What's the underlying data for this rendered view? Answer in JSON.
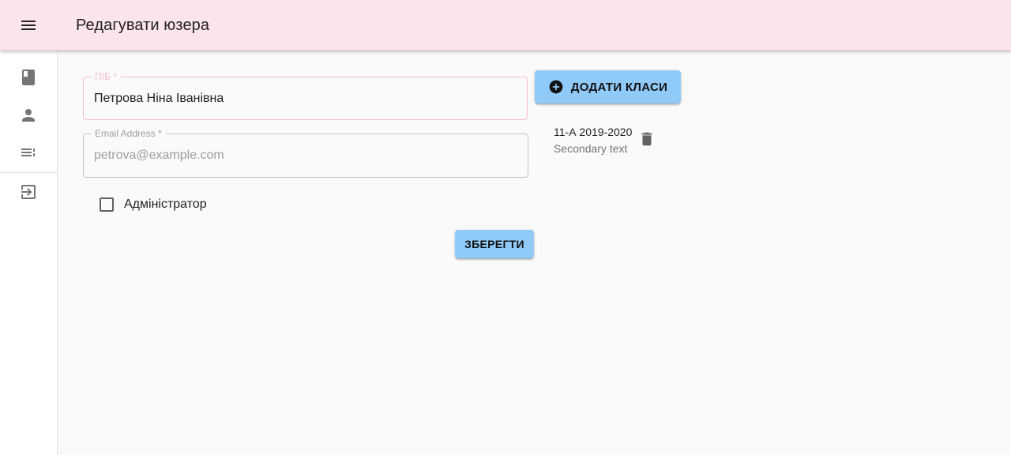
{
  "app_bar": {
    "title": "Редагувати юзера",
    "menu_icon": "menu-icon"
  },
  "drawer": {
    "items": [
      {
        "icon": "book-icon",
        "name": "drawer-item-book"
      },
      {
        "icon": "person-icon",
        "name": "drawer-item-users"
      },
      {
        "icon": "list-icon",
        "name": "drawer-item-list"
      },
      {
        "icon": "logout-icon",
        "name": "drawer-item-logout"
      }
    ]
  },
  "form": {
    "name_field": {
      "label": "ПІБ *",
      "value": "Петрова Ніна Іванівна"
    },
    "email_field": {
      "label": "Email Address *",
      "value": "",
      "placeholder": "petrova@example.com"
    },
    "admin_checkbox": {
      "label": "Адміністратор",
      "checked": false
    },
    "save_label": "Зберегти"
  },
  "classes": {
    "add_label": "Додати класи",
    "add_icon": "add-circle-icon",
    "items": [
      {
        "primary": "11-А 2019-2020",
        "secondary": "Secondary text",
        "delete_icon": "delete-icon"
      }
    ]
  },
  "colors": {
    "app_bar_bg": "#fce4ec",
    "button_bg": "#90caf9",
    "focused_outline": "#f8bbd0"
  }
}
